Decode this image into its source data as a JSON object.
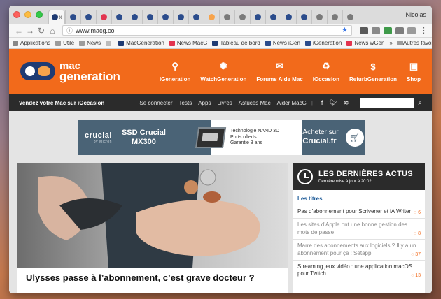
{
  "browser": {
    "profile": "Nicolas",
    "tab_close": "x",
    "tabs": [
      {
        "color": "#1f3b73",
        "active": true
      },
      {
        "color": "#2b4c8c"
      },
      {
        "color": "#2b4c8c"
      },
      {
        "color": "#e2344f"
      },
      {
        "color": "#2b4c8c"
      },
      {
        "color": "#2b4c8c"
      },
      {
        "color": "#2b4c8c"
      },
      {
        "color": "#2b4c8c"
      },
      {
        "color": "#2b4c8c"
      },
      {
        "color": "#2b4c8c"
      },
      {
        "color": "#f7a34b"
      },
      {
        "color": "#7a7a7a"
      },
      {
        "color": "#7a7a7a"
      },
      {
        "color": "#2b4c8c"
      },
      {
        "color": "#2b4c8c"
      },
      {
        "color": "#2b4c8c"
      },
      {
        "color": "#2b4c8c"
      },
      {
        "color": "#7a7a7a"
      },
      {
        "color": "#7a7a7a"
      },
      {
        "color": "#7a7a7a"
      }
    ],
    "url": "www.macg.co",
    "bookmarks": [
      {
        "label": "Applications",
        "icon": "apps-icon",
        "color": "#888888"
      },
      {
        "label": "Utile",
        "icon": "folder-icon",
        "color": "#9c9c9c"
      },
      {
        "label": "News",
        "icon": "folder-icon",
        "color": "#9c9c9c"
      },
      {
        "label": "",
        "icon": "page-icon",
        "color": "#bcbcbc"
      },
      {
        "label": "MacGeneration",
        "icon": "site-icon",
        "color": "#1f3b73"
      },
      {
        "label": "News MacG",
        "icon": "site-icon",
        "color": "#e2344f"
      },
      {
        "label": "Tableau de bord",
        "icon": "site-icon",
        "color": "#1f3b73"
      },
      {
        "label": "News iGen",
        "icon": "site-icon",
        "color": "#2b4c8c"
      },
      {
        "label": "iGeneration",
        "icon": "site-icon",
        "color": "#2b4c8c"
      },
      {
        "label": "News wGen",
        "icon": "site-icon",
        "color": "#e2344f"
      }
    ],
    "bookmarks_more": "»",
    "other_bookmarks": "Autres favoris"
  },
  "site": {
    "logo_line1": "mac",
    "logo_line2": "generation",
    "nav": [
      {
        "label": "iGeneration",
        "icon": "network-icon"
      },
      {
        "label": "WatchGeneration",
        "icon": "watch-icon"
      },
      {
        "label": "Forums Aide Mac",
        "icon": "chat-icon"
      },
      {
        "label": "iOccasion",
        "icon": "recycle-icon"
      },
      {
        "label": "RefurbGeneration",
        "icon": "dollar-icon"
      },
      {
        "label": "Shop",
        "icon": "bag-icon"
      }
    ],
    "promo": "Vendez votre Mac sur iOccasion",
    "links": [
      "Se connecter",
      "Tests",
      "Apps",
      "Livres",
      "Astuces Mac",
      "Aider MacG"
    ],
    "accent_color": "#f26a1b"
  },
  "ad": {
    "brand": "crucial",
    "brand_sub": "by Micron",
    "model_line1": "SSD Crucial",
    "model_line2": "MX300",
    "features": [
      "Technologie NAND 3D",
      "Ports offerts",
      "Garantie 3 ans"
    ],
    "cta_line1": "Acheter sur",
    "cta_line2": "Crucial.fr"
  },
  "hero": {
    "title": "Ulysses passe à l’abonnement, c’est grave docteur ?"
  },
  "sidebar": {
    "title": "LES DERNIÈRES ACTUS",
    "subtitle": "Dernière mise à jour à 20:02",
    "section": "Les titres",
    "items": [
      {
        "title": "Pas d’abonnement pour Scrivener et iA Writer",
        "count": "6",
        "dim": false
      },
      {
        "title": "Les sites d’Apple ont une bonne gestion des mots de passe",
        "count": "8",
        "dim": true
      },
      {
        "title": "Marre des abonnements aux logiciels ? Il y a un abonnement pour ça : Setapp",
        "count": "37",
        "dim": true
      },
      {
        "title": "Streaming jeux vidéo : une application macOS pour Twitch",
        "count": "13",
        "dim": false
      }
    ]
  }
}
